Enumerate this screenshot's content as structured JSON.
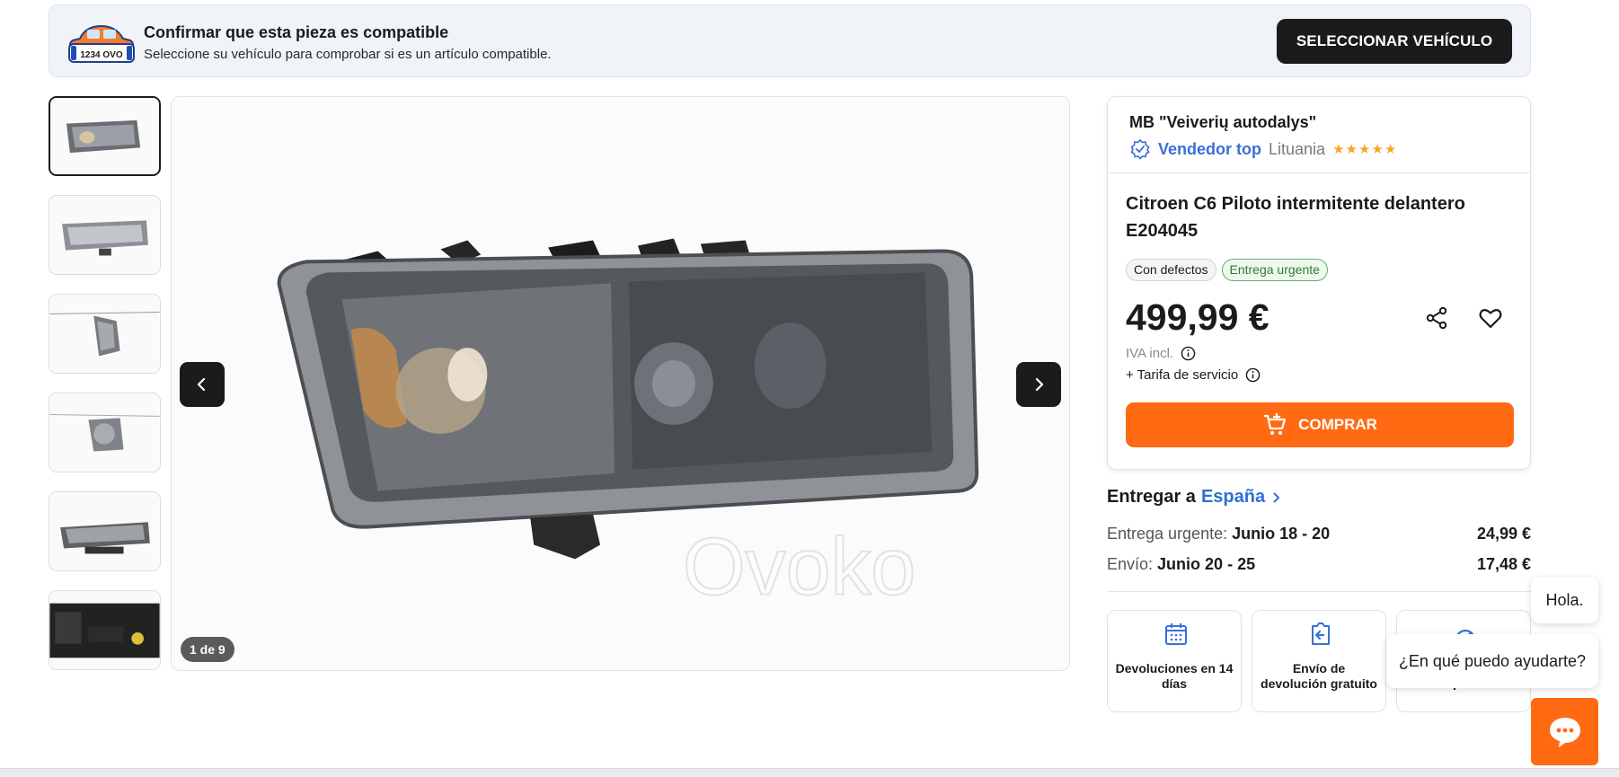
{
  "compat_banner": {
    "plate_text": "1234 OVO",
    "title": "Confirmar que esta pieza es compatible",
    "subtitle": "Seleccione su vehículo para comprobar si es un artículo compatible.",
    "button_label": "SELECCIONAR VEHÍCULO"
  },
  "gallery": {
    "thumbnail_count": 6,
    "active_index": 0,
    "counter": "1 de 9",
    "watermark": "Ovoko",
    "prev_icon": "chevron-left-icon",
    "next_icon": "chevron-right-icon"
  },
  "product": {
    "seller_name": "MB \"Veiverių autodalys\"",
    "seller_badge": "Vendedor top",
    "seller_country": "Lituania",
    "seller_stars": "★★★★★",
    "title": "Citroen C6 Piloto intermitente delantero E204045",
    "tags": {
      "condition": "Con defectos",
      "urgent": "Entrega urgente"
    },
    "price": "499,99 €",
    "vat": "IVA incl.",
    "service_fee": "+ Tarifa de servicio",
    "buy_label": "COMPRAR"
  },
  "delivery": {
    "prefix": "Entregar a",
    "country": "España",
    "urgent": {
      "label": "Entrega urgente:",
      "dates": "Junio 18 - 20",
      "cost": "24,99 €"
    },
    "standard": {
      "label": "Envío:",
      "dates": "Junio 20 - 25",
      "cost": "17,48 €"
    }
  },
  "benefits": [
    {
      "icon": "calendar-icon",
      "text": "Devoluciones en 14 días"
    },
    {
      "icon": "return-box-icon",
      "text": "Envío de devolución gratuito"
    },
    {
      "icon": "speedometer-icon",
      "text": "rápidos"
    }
  ],
  "chat": {
    "greeting": "Hola.",
    "question": "¿En qué puedo ayudarte?"
  },
  "colors": {
    "accent": "#ff6a13",
    "link": "#2f6fd4",
    "dark_button": "#1b1b1b",
    "star": "#f5a623"
  }
}
